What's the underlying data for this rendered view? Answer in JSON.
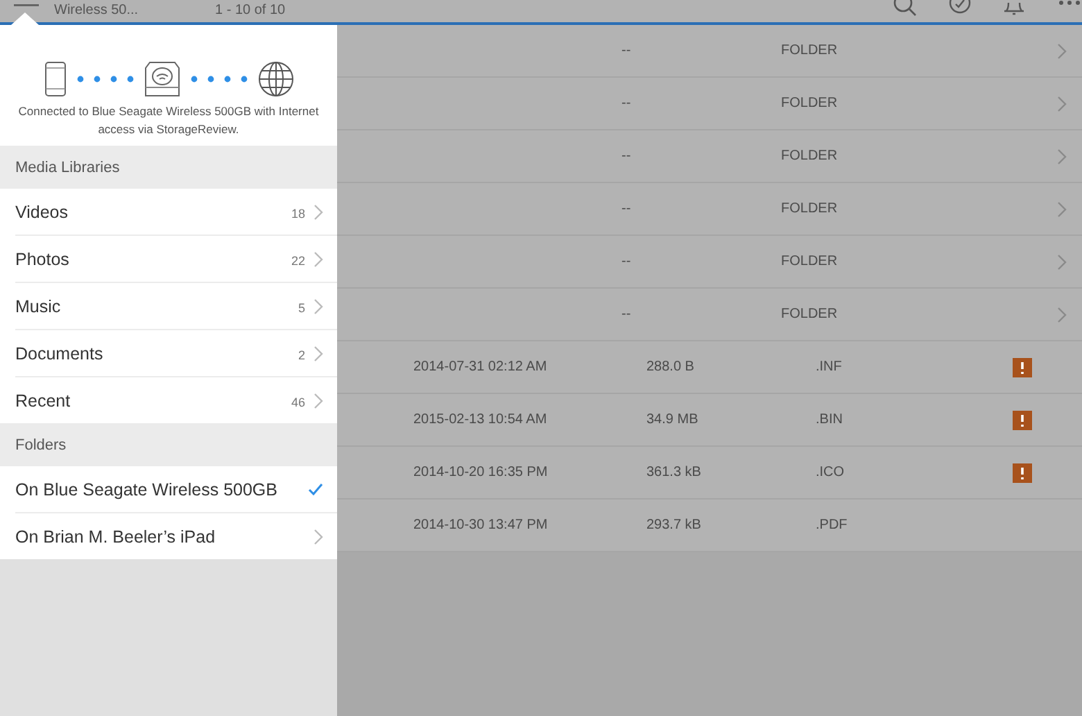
{
  "top_bar": {
    "title": "Wireless 50...",
    "count": "1 - 10 of 10"
  },
  "file_list": {
    "rows": [
      {
        "kind": "folder",
        "size": "--",
        "type": "FOLDER"
      },
      {
        "kind": "folder",
        "size": "--",
        "type": "FOLDER"
      },
      {
        "kind": "folder",
        "size": "--",
        "type": "FOLDER"
      },
      {
        "kind": "folder",
        "size": "--",
        "type": "FOLDER"
      },
      {
        "kind": "folder",
        "size": "--",
        "type": "FOLDER"
      },
      {
        "kind": "folder",
        "size": "--",
        "type": "FOLDER"
      },
      {
        "kind": "file",
        "date": "2014-07-31 02:12 AM",
        "size": "288.0 B",
        "type": ".INF",
        "warning": true
      },
      {
        "kind": "file",
        "date": "2015-02-13 10:54 AM",
        "size": "34.9 MB",
        "type": ".BIN",
        "warning": true
      },
      {
        "kind": "file",
        "date": "2014-10-20 16:35 PM",
        "size": "361.3 kB",
        "type": ".ICO",
        "warning": true
      },
      {
        "kind": "file",
        "date": "2014-10-30 13:47 PM",
        "size": "293.7 kB",
        "type": ".PDF",
        "warning": false
      }
    ]
  },
  "popover": {
    "connection_text": "Connected to Blue Seagate Wireless 500GB with Internet access via StorageReview.",
    "sections": [
      {
        "header": "Media Libraries",
        "items": [
          {
            "label": "Videos",
            "count": "18",
            "selected": false
          },
          {
            "label": "Photos",
            "count": "22",
            "selected": false
          },
          {
            "label": "Music",
            "count": "5",
            "selected": false
          },
          {
            "label": "Documents",
            "count": "2",
            "selected": false
          },
          {
            "label": "Recent",
            "count": "46",
            "selected": false
          }
        ]
      },
      {
        "header": "Folders",
        "items": [
          {
            "label": "On Blue Seagate Wireless 500GB",
            "selected": true
          },
          {
            "label": "On Brian M. Beeler’s iPad",
            "selected": false
          }
        ]
      }
    ]
  }
}
